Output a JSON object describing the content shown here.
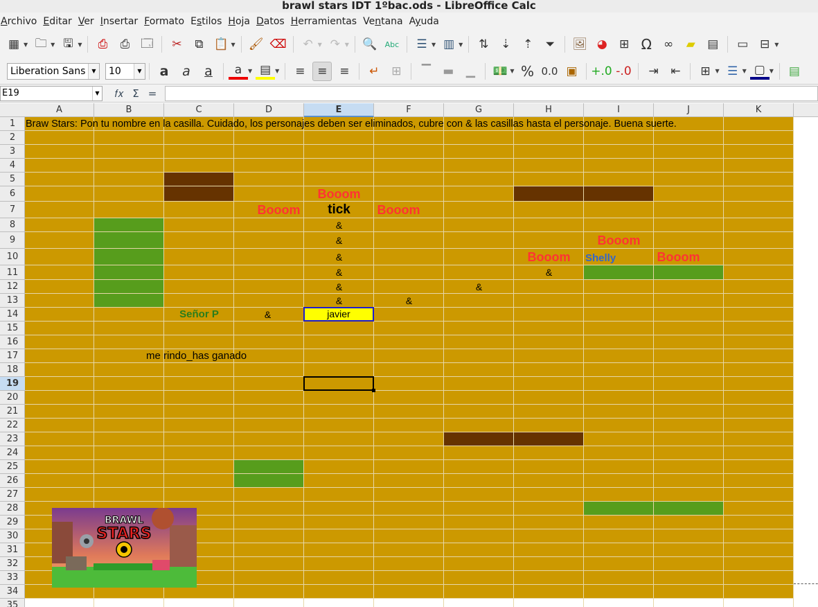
{
  "window": {
    "title": "brawl stars IDT 1ºbac.ods - LibreOffice Calc"
  },
  "menu": [
    {
      "label": "Archivo",
      "key": "A"
    },
    {
      "label": "Editar",
      "key": "E"
    },
    {
      "label": "Ver",
      "key": "V"
    },
    {
      "label": "Insertar",
      "key": "I"
    },
    {
      "label": "Formato",
      "key": "F"
    },
    {
      "label": "Estilos",
      "key": "s"
    },
    {
      "label": "Hoja",
      "key": "H"
    },
    {
      "label": "Datos",
      "key": "D"
    },
    {
      "label": "Herramientas",
      "key": "H"
    },
    {
      "label": "Ventana",
      "key": "n"
    },
    {
      "label": "Ayuda",
      "key": "y"
    }
  ],
  "format": {
    "font_name": "Liberation Sans",
    "font_size": "10"
  },
  "formula_bar": {
    "cell_ref": "E19",
    "content": ""
  },
  "columns": [
    "A",
    "B",
    "C",
    "D",
    "E",
    "F",
    "G",
    "H",
    "I",
    "J",
    "K"
  ],
  "rows": [
    "1",
    "2",
    "3",
    "4",
    "5",
    "6",
    "7",
    "8",
    "9",
    "10",
    "11",
    "12",
    "13",
    "14",
    "15",
    "16",
    "17",
    "18",
    "19",
    "20",
    "21",
    "22",
    "23",
    "24",
    "25",
    "26",
    "27",
    "28",
    "29",
    "30",
    "31",
    "32",
    "33",
    "34",
    "35"
  ],
  "selected": {
    "column": "E",
    "row": "19"
  },
  "sheet": {
    "background": "#cc9900",
    "title_cell": {
      "ref": "A1",
      "text": "Braw Stars: Pon tu nombre en la casilla. Cuidado, los personajes deben ser eliminados, cubre con & las casillas hasta el personaje. Buena suerte."
    },
    "boom_label": "Booom",
    "amp": "&",
    "tick": "tick",
    "shelly": "Shelly",
    "senor_p": "Señor P",
    "player_name": "javier",
    "surrender": "me rindo_has ganado",
    "dark_fill": "#663300",
    "green_fill": "#579d1c",
    "image_caption": "BRAWL STARS"
  },
  "toolbar_icons": [
    "new-icon",
    "open-icon",
    "save-icon",
    "export-pdf-icon",
    "print-icon",
    "print-preview-icon",
    "cut-icon",
    "copy-icon",
    "paste-icon",
    "clone-format-icon",
    "clear-format-icon",
    "undo-icon",
    "redo-icon",
    "find-replace-icon",
    "spelling-icon",
    "row-icon",
    "column-icon",
    "sort-icon",
    "sort-ascending-icon",
    "sort-descending-icon",
    "autofilter-icon",
    "image-icon",
    "chart-icon",
    "pivot-table-icon",
    "special-character-icon",
    "hyperlink-icon",
    "comment-icon",
    "header-footer-icon",
    "define-print-area-icon",
    "freeze-icon"
  ]
}
